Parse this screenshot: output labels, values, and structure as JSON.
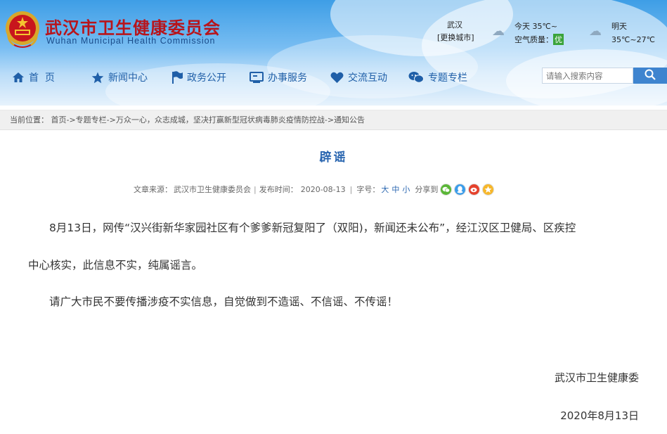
{
  "header": {
    "site_title": "武汉市卫生健康委员会",
    "site_subtitle": "Wuhan Municipal Health Commission",
    "weather": {
      "city": "武汉",
      "change_city": "[更换城市]",
      "today": "今天 35℃~",
      "air_quality_label": "空气质量：",
      "air_quality_value": "优",
      "tomorrow_label": "明天",
      "tomorrow_temp": "35℃~27℃"
    }
  },
  "nav": {
    "items": [
      {
        "label": "首  页",
        "icon": "home-icon"
      },
      {
        "label": "新闻中心",
        "icon": "star-icon"
      },
      {
        "label": "政务公开",
        "icon": "flag-icon"
      },
      {
        "label": "办事服务",
        "icon": "monitor-icon"
      },
      {
        "label": "交流互动",
        "icon": "heart-icon"
      },
      {
        "label": "专题专栏",
        "icon": "chat-icon"
      }
    ],
    "search_placeholder": "请输入搜索内容",
    "search_icon": "search-icon"
  },
  "breadcrumb": {
    "label": "当前位置：",
    "path": "首页->专题专栏->万众一心，众志成城，坚决打赢新型冠状病毒肺炎疫情防控战->通知公告"
  },
  "article": {
    "title": "辟谣",
    "source_label": "文章来源：",
    "source": "武汉市卫生健康委员会",
    "date_label": "发布时间：",
    "date": "2020-08-13",
    "font_size_label": "字号：",
    "font_sizes": [
      "大",
      "中",
      "小"
    ],
    "share_label": "分享到",
    "share_icons": [
      "wechat-icon",
      "qq-icon",
      "weibo-icon",
      "qzone-icon"
    ],
    "paragraph1_line1": "8月13日，网传“汉兴街新华家园社区有个爹爹新冠复阳了（双阳)，新闻还未公布”，经江汉区卫健局、区疾控",
    "paragraph1_line2": "中心核实，此信息不实，纯属谣言。",
    "paragraph2": "请广大市民不要传播涉疫不实信息，自觉做到不造谣、不信谣、不传谣！",
    "signature": "武汉市卫生健康委",
    "signature_date": "2020年8月13日"
  },
  "colors": {
    "brand_red": "#b8141b",
    "nav_blue": "#1f5fa8",
    "title_blue": "#2a66b0",
    "search_button": "#3e84cf",
    "air_quality_badge": "#3aa33a"
  }
}
